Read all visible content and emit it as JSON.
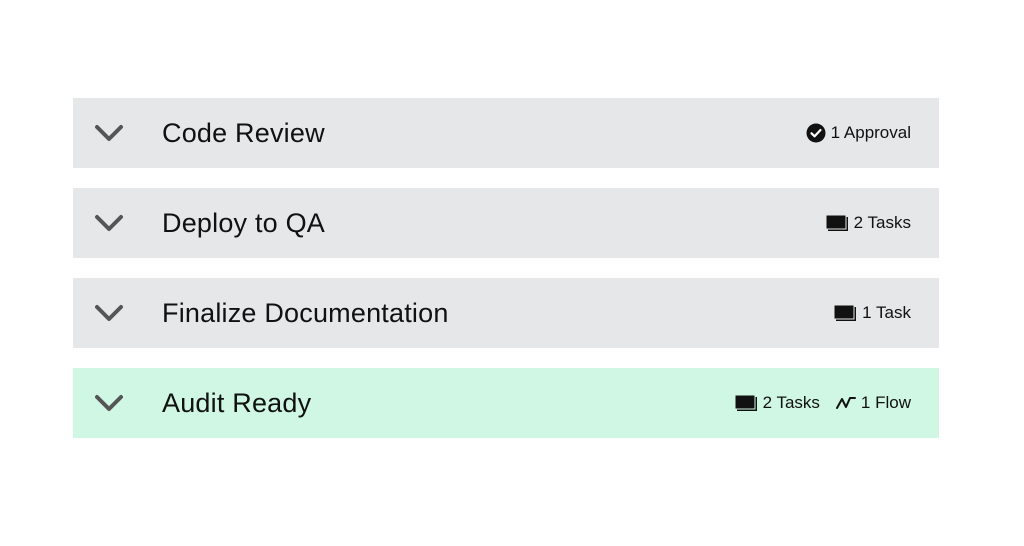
{
  "stages": [
    {
      "title": "Code Review",
      "active": false,
      "badges": [
        {
          "icon": "check-circle-icon",
          "label": "1 Approval"
        }
      ]
    },
    {
      "title": "Deploy to QA",
      "active": false,
      "badges": [
        {
          "icon": "tasks-icon",
          "label": "2 Tasks"
        }
      ]
    },
    {
      "title": "Finalize Documentation",
      "active": false,
      "badges": [
        {
          "icon": "tasks-icon",
          "label": "1 Task"
        }
      ]
    },
    {
      "title": "Audit Ready",
      "active": true,
      "badges": [
        {
          "icon": "tasks-icon",
          "label": "2 Tasks"
        },
        {
          "icon": "flow-icon",
          "label": "1 Flow"
        }
      ]
    }
  ],
  "colors": {
    "row_background": "#e6e7e9",
    "active_row_background": "#cff7e3",
    "chevron": "#555555",
    "text": "#111111"
  }
}
